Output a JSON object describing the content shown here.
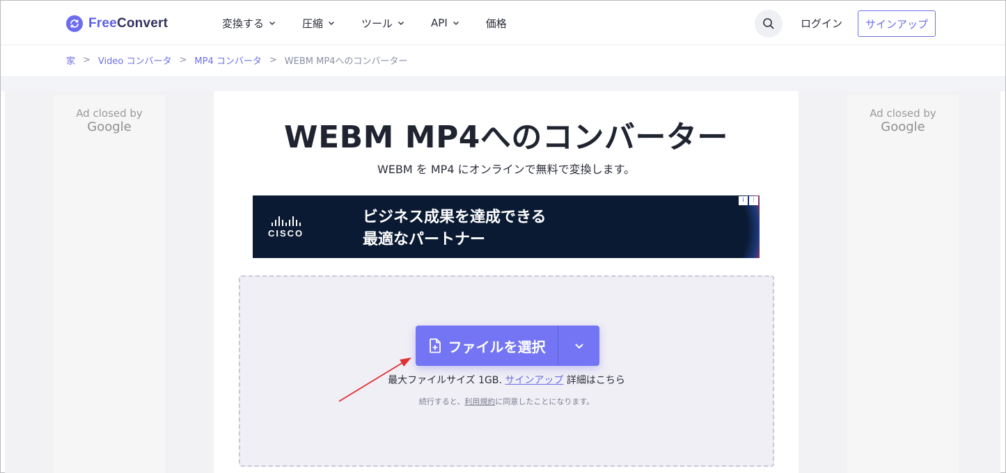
{
  "header": {
    "logo": {
      "free": "Free",
      "convert": "Convert"
    },
    "nav": [
      {
        "label": "変換する",
        "has_dropdown": true
      },
      {
        "label": "圧縮",
        "has_dropdown": true
      },
      {
        "label": "ツール",
        "has_dropdown": true
      },
      {
        "label": "API",
        "has_dropdown": true
      },
      {
        "label": "価格",
        "has_dropdown": false
      }
    ],
    "search_icon": "search-icon",
    "login_label": "ログイン",
    "signup_label": "サインアップ"
  },
  "breadcrumb": {
    "items": [
      "家",
      "Video コンバータ",
      "MP4 コンバータ"
    ],
    "current": "WEBM MP4へのコンバーター",
    "separator": ">"
  },
  "ads": {
    "left": {
      "line1": "Ad closed by",
      "line2": "Google"
    },
    "right": {
      "line1": "Ad closed by",
      "line2": "Google"
    },
    "banner": {
      "brand": "CISCO",
      "line1": "ビジネス成果を達成できる",
      "line2": "最適なパートナー"
    }
  },
  "main": {
    "title": "WEBM MP4へのコンバーター",
    "subtitle": "WEBM を MP4 にオンラインで無料で変換します。"
  },
  "dropzone": {
    "choose_label": "ファイルを選択",
    "max_prefix": "最大ファイルサイズ 1GB.",
    "signup_link": "サインアップ",
    "max_suffix": "詳細はこちら",
    "terms_prefix": "続行すると、",
    "terms_link": "利用規約",
    "terms_suffix": "に同意したことになります。"
  },
  "colors": {
    "accent": "#7375f4",
    "link": "#6b6ee8",
    "annotation_arrow": "#e03131"
  }
}
